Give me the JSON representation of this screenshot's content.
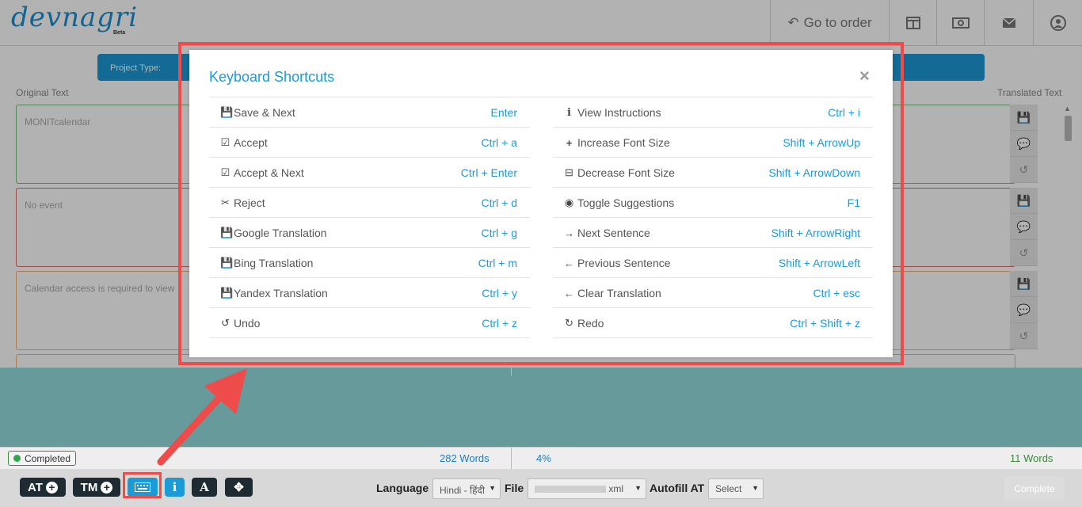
{
  "header": {
    "logo_text": "devnagri",
    "logo_sub": "Beta",
    "goto_label": "Go to order",
    "icons": [
      "columns-icon",
      "money-icon",
      "mail-icon",
      "user-icon"
    ]
  },
  "project_bar": {
    "label": "Project Type:"
  },
  "columns": {
    "left": "Original Text",
    "right": "Translated Text"
  },
  "rows": [
    {
      "text": "MONITcalendar",
      "border": "#7ac27a"
    },
    {
      "text": "No event",
      "border": "#e06b6b"
    },
    {
      "text": "Calendar access is required to view",
      "border": "#f2b27a"
    }
  ],
  "modal": {
    "title": "Keyboard Shortcuts",
    "close": "×",
    "left_shortcuts": [
      {
        "icon": "save-icon",
        "label": "Save & Next",
        "key": "Enter"
      },
      {
        "icon": "check-square-icon",
        "label": "Accept",
        "key": "Ctrl + a"
      },
      {
        "icon": "check-square-icon",
        "label": "Accept & Next",
        "key": "Ctrl + Enter"
      },
      {
        "icon": "eraser-icon",
        "label": "Reject",
        "key": "Ctrl + d"
      },
      {
        "icon": "save-icon",
        "label": "Google Translation",
        "key": "Ctrl + g"
      },
      {
        "icon": "save-icon",
        "label": "Bing Translation",
        "key": "Ctrl + m"
      },
      {
        "icon": "save-icon",
        "label": "Yandex Translation",
        "key": "Ctrl + y"
      },
      {
        "icon": "undo-icon",
        "label": "Undo",
        "key": "Ctrl + z"
      }
    ],
    "right_shortcuts": [
      {
        "icon": "info-icon",
        "label": "View Instructions",
        "key": "Ctrl + i"
      },
      {
        "icon": "plus-icon",
        "label": "Increase Font Size",
        "key": "Shift + ArrowUp"
      },
      {
        "icon": "minus-square-icon",
        "label": "Decrease Font Size",
        "key": "Shift + ArrowDown"
      },
      {
        "icon": "eye-slash-icon",
        "label": "Toggle Suggestions",
        "key": "F1"
      },
      {
        "icon": "arrow-right-icon",
        "label": "Next Sentence",
        "key": "Shift + ArrowRight"
      },
      {
        "icon": "arrow-left-icon",
        "label": "Previous Sentence",
        "key": "Shift + ArrowLeft"
      },
      {
        "icon": "arrow-left-icon",
        "label": "Clear Translation",
        "key": "Ctrl + esc"
      },
      {
        "icon": "redo-icon",
        "label": "Redo",
        "key": "Ctrl + Shift + z"
      }
    ]
  },
  "status": {
    "badge": "Completed",
    "words_left": "282 Words",
    "percent": "4%",
    "words_right": "11 Words"
  },
  "toolbar": {
    "at_label": "AT",
    "tm_label": "TM",
    "info_glyph": "i",
    "font_glyph": "A",
    "language_label": "Language",
    "language_value": "Hindi - हिंदी",
    "file_label": "File",
    "file_value": "xml",
    "autofill_label": "Autofill AT",
    "autofill_value": "Select",
    "complete_label": "Complete"
  },
  "colors": {
    "accent": "#1c9ad6",
    "highlight": "#ee4b4b",
    "overlay_teal": "#679a9a"
  }
}
